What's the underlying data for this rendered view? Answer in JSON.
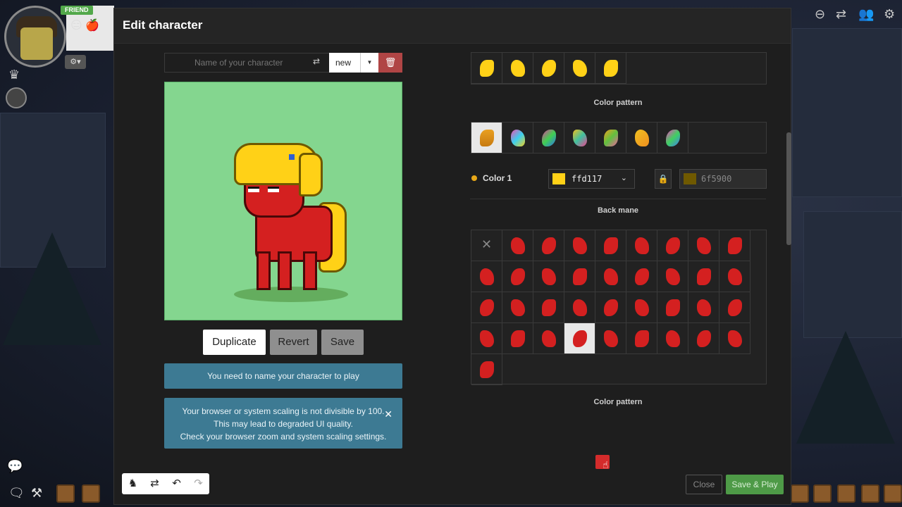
{
  "hud": {
    "friend_badge": "FRIEND",
    "emoji_1": "😑",
    "emoji_2": "🍎"
  },
  "modal": {
    "title": "Edit character"
  },
  "character": {
    "name_value": "",
    "name_placeholder": "Name of your character",
    "select_value": "new"
  },
  "actions": {
    "duplicate": "Duplicate",
    "revert": "Revert",
    "save": "Save",
    "close": "Close",
    "save_play": "Save & Play"
  },
  "notices": {
    "name_required": "You need to name your character to play",
    "scaling_line1": "Your browser or system scaling is not divisible by 100.",
    "scaling_line2": "This may lead to degraded UI quality.",
    "scaling_line3": "Check your browser zoom and system scaling settings."
  },
  "panel": {
    "section_color_pattern_1": "Color pattern",
    "color1_label": "Color 1",
    "color1_value": "ffd117",
    "color2_value": "6f5900",
    "section_back_mane": "Back mane",
    "section_color_pattern_2": "Color pattern",
    "mane_shapes_count": 5,
    "color_patterns_count": 7,
    "back_mane_count": 37,
    "back_mane_selected_index": 30
  },
  "colors": {
    "mane_yellow": "#ffd117",
    "mane_shadow": "#6f5900",
    "body_red": "#d42020",
    "preview_bg": "#84d68f",
    "save_play_green": "#4e9a47",
    "notice_blue": "#3d7a93"
  }
}
